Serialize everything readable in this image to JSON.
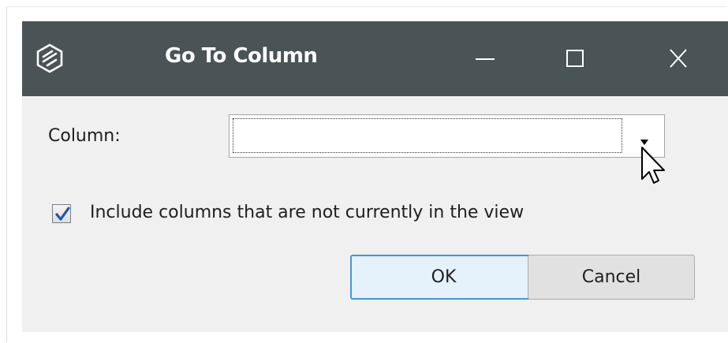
{
  "window": {
    "title": "Go To Column",
    "minimize_icon": "minimize-icon",
    "maximize_icon": "maximize-icon",
    "close_icon": "close-icon"
  },
  "form": {
    "column_label": "Column:",
    "column_value": "",
    "include_hidden_label": "Include columns that are not currently in the view",
    "include_hidden_checked": true
  },
  "buttons": {
    "ok_label": "OK",
    "cancel_label": "Cancel"
  },
  "colors": {
    "titlebar": "#4a5356",
    "dialog_bg": "#f0f0f0",
    "default_button_border": "#3d9ad9",
    "check_mark": "#2255aa"
  }
}
